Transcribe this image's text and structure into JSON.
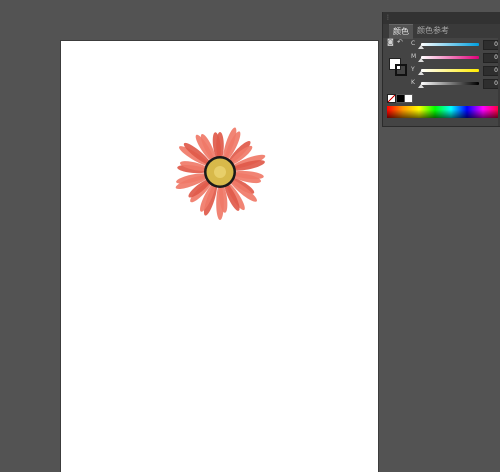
{
  "color_panel": {
    "tabs": [
      {
        "label": "颜色"
      },
      {
        "label": "颜色参考"
      }
    ],
    "sliders": [
      {
        "channel": "C",
        "value": "0",
        "track_color": "linear-gradient(to right,#ffffff,#00a0e0)"
      },
      {
        "channel": "M",
        "value": "0",
        "track_color": "linear-gradient(to right,#ffffff,#e2007a)"
      },
      {
        "channel": "Y",
        "value": "0",
        "track_color": "linear-gradient(to right,#ffffff,#ffec00)"
      },
      {
        "channel": "K",
        "value": "0",
        "track_color": "linear-gradient(to right,#ffffff,#000000)"
      }
    ],
    "fill_color": "#ffffff",
    "stroke_color": "#111111"
  },
  "artwork": {
    "petal_color": "#f07a68",
    "petal_dark": "#e05a4a",
    "center_color": "#d8b94a",
    "center_ring": "#1a1a1a"
  }
}
